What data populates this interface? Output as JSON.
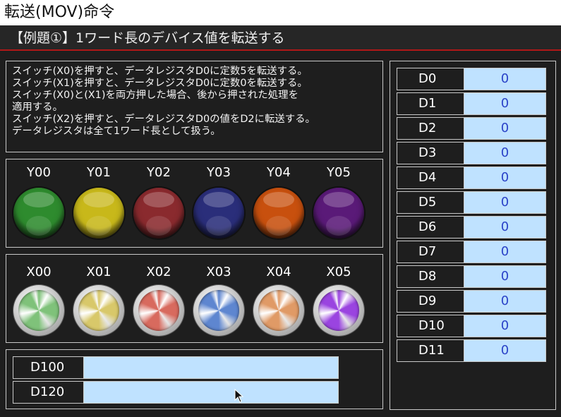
{
  "window_title": "転送(MOV)命令",
  "sub_header": "【例題①】1ワード長のデバイス値を転送する",
  "description": [
    "スイッチ(X0)を押すと、データレジスタD0に定数5を転送する。",
    "スイッチ(X1)を押すと、データレジスタD0に定数0を転送する。",
    "スイッチ(X0)と(X1)を両方押した場合、後から押された処理を",
    "適用する。",
    "スイッチ(X2)を押すと、データレジスタD0の値をD2に転送する。",
    "データレジスタは全て1ワード長として扱う。"
  ],
  "lamps": [
    {
      "label": "Y00",
      "color": "#2e8b2e"
    },
    {
      "label": "Y01",
      "color": "#c8b81a"
    },
    {
      "label": "Y02",
      "color": "#8a2a2e"
    },
    {
      "label": "Y03",
      "color": "#2a2e7a"
    },
    {
      "label": "Y04",
      "color": "#c8500e"
    },
    {
      "label": "Y05",
      "color": "#5a1a78"
    }
  ],
  "switches": [
    {
      "label": "X00",
      "color": "#7fc27a"
    },
    {
      "label": "X01",
      "color": "#d8c86a"
    },
    {
      "label": "X02",
      "color": "#d86a5e"
    },
    {
      "label": "X03",
      "color": "#5e86d0"
    },
    {
      "label": "X04",
      "color": "#e09a66"
    },
    {
      "label": "X05",
      "color": "#9a44e0"
    }
  ],
  "devices": [
    {
      "name": "D100",
      "value": ""
    },
    {
      "name": "D120",
      "value": ""
    }
  ],
  "registers": [
    {
      "name": "D0",
      "value": "0"
    },
    {
      "name": "D1",
      "value": "0"
    },
    {
      "name": "D2",
      "value": "0"
    },
    {
      "name": "D3",
      "value": "0"
    },
    {
      "name": "D4",
      "value": "0"
    },
    {
      "name": "D5",
      "value": "0"
    },
    {
      "name": "D6",
      "value": "0"
    },
    {
      "name": "D7",
      "value": "0"
    },
    {
      "name": "D8",
      "value": "0"
    },
    {
      "name": "D9",
      "value": "0"
    },
    {
      "name": "D10",
      "value": "0"
    },
    {
      "name": "D11",
      "value": "0"
    }
  ],
  "icons": {
    "cursor": "mouse-pointer-icon"
  }
}
